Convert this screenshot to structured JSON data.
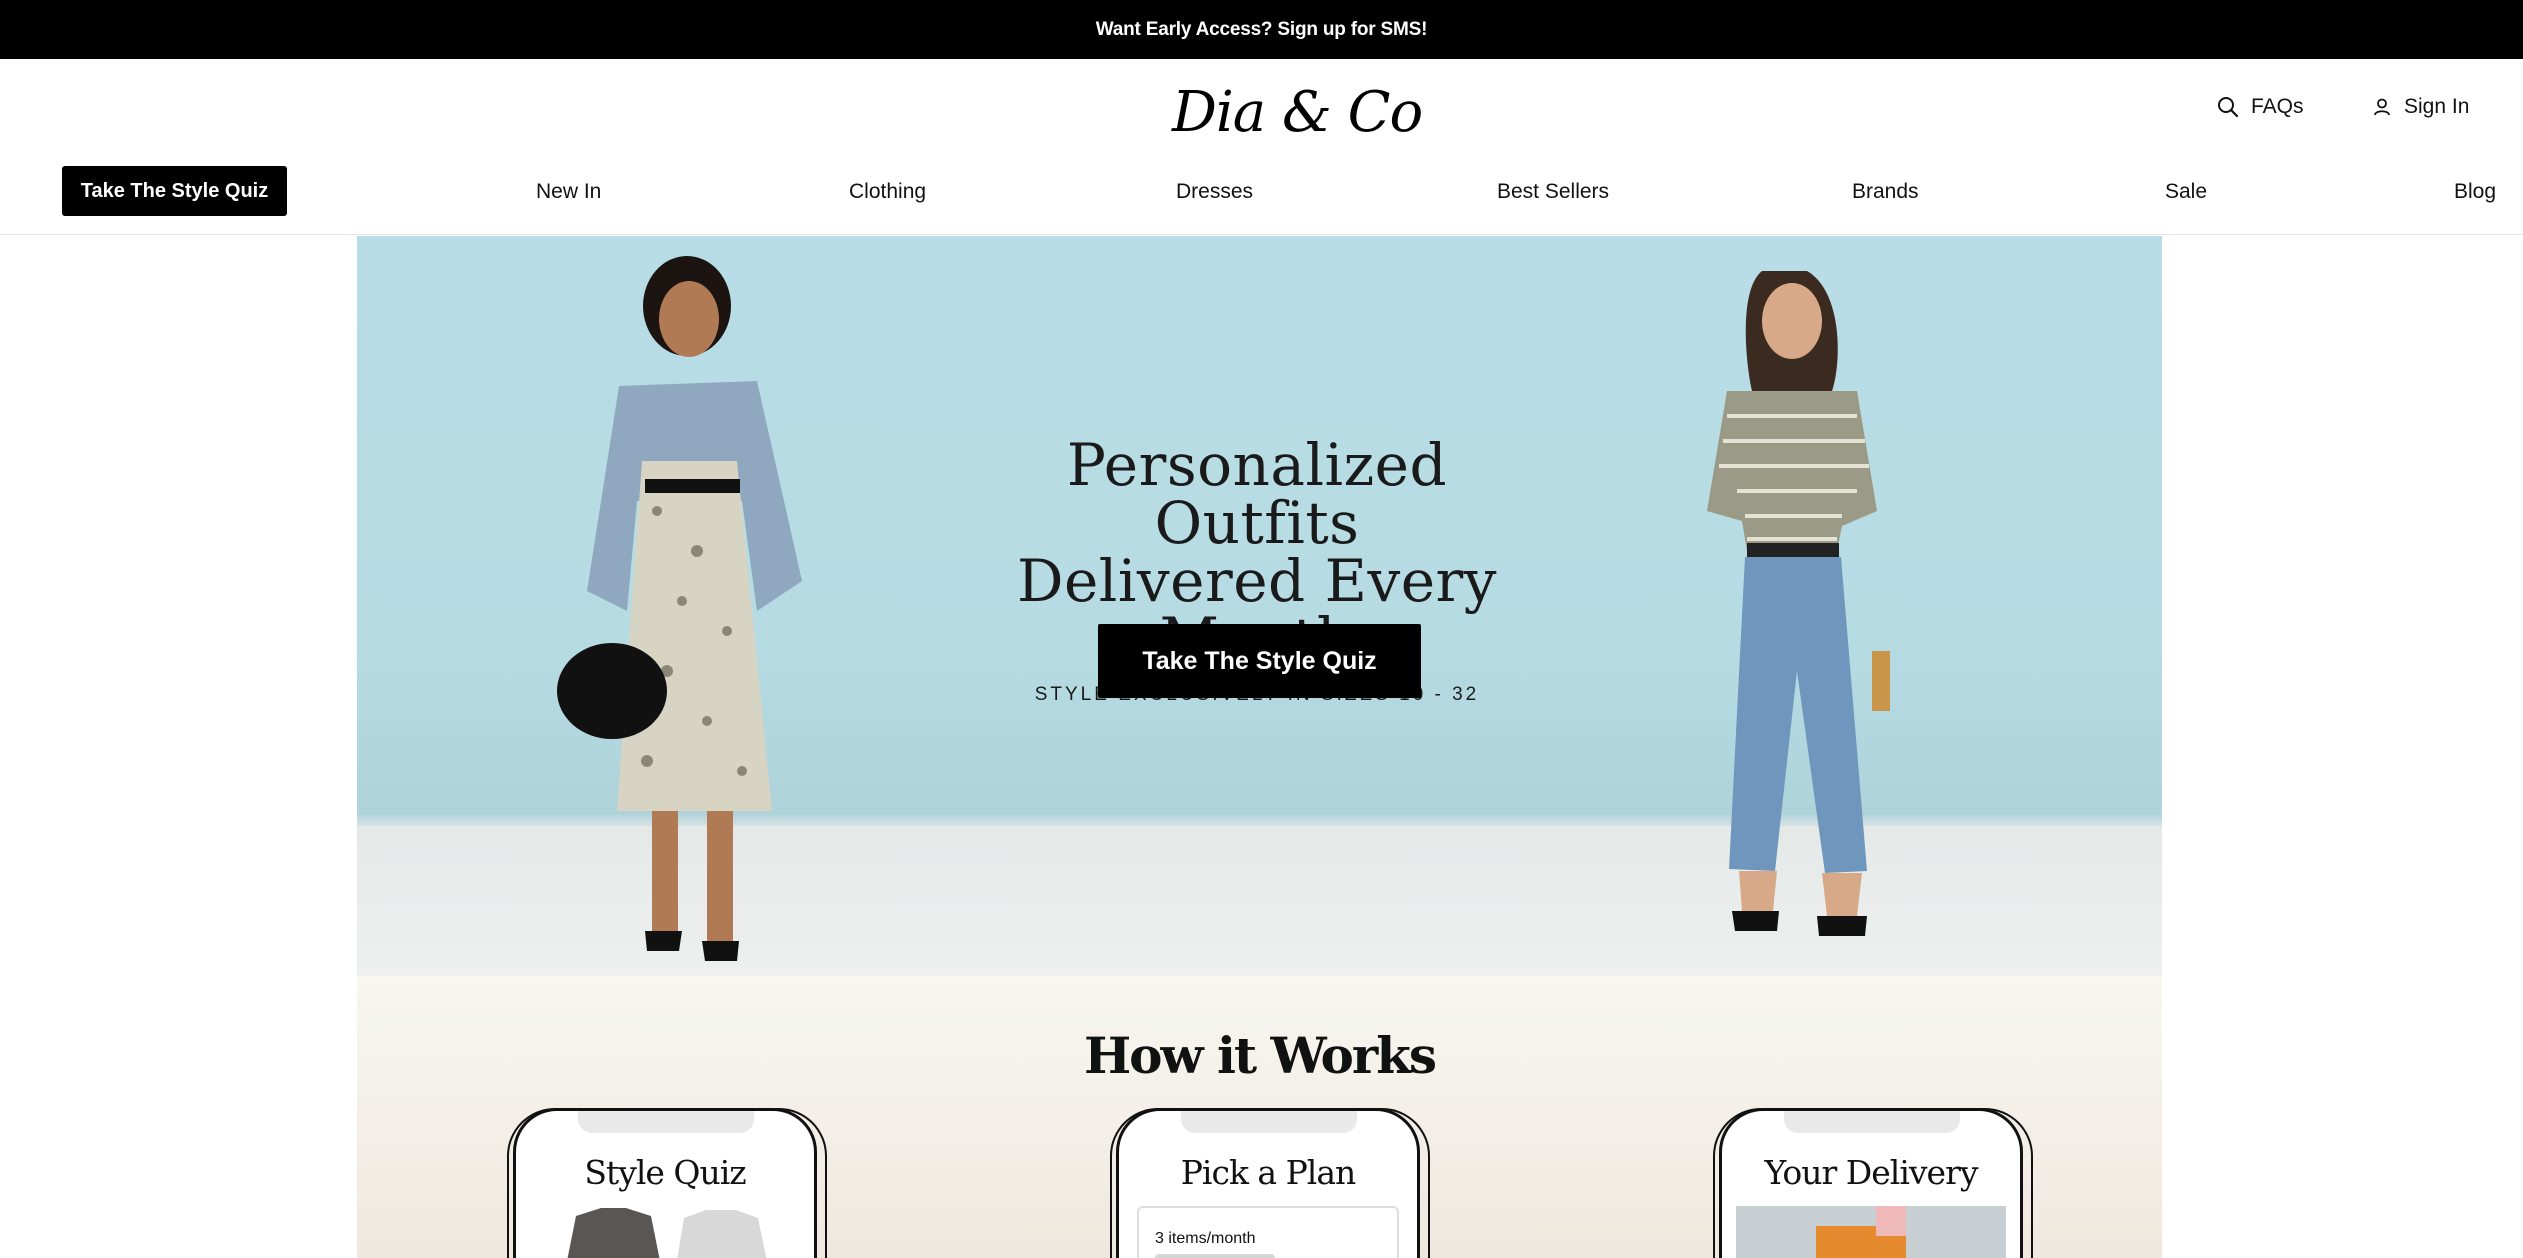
{
  "promo": {
    "text": "Want Early Access? Sign up for SMS!"
  },
  "header": {
    "logo": "Dia & Co",
    "faqs_label": "FAQs",
    "sign_in_label": "Sign In"
  },
  "nav": {
    "quiz_button": "Take The Style Quiz",
    "items": [
      "New In",
      "Clothing",
      "Dresses",
      "Best Sellers",
      "Brands",
      "Sale",
      "Blog"
    ]
  },
  "hero": {
    "title_line1": "Personalized Outfits",
    "title_line2": "Delivered Every Month",
    "subtitle": "STYLE EXCLUSIVELY IN SIZES 10 - 32",
    "cta": "Take The Style Quiz"
  },
  "how_it_works": {
    "title": "How it Works",
    "steps": [
      {
        "title": "Style Quiz"
      },
      {
        "title": "Pick a Plan",
        "option": "3 items/month"
      },
      {
        "title": "Your Delivery"
      }
    ]
  },
  "colors": {
    "promo_bg": "#000000",
    "hero_bg": "#b9dde6",
    "cta_bg": "#000000",
    "how_bg": "#f8f6f1"
  }
}
